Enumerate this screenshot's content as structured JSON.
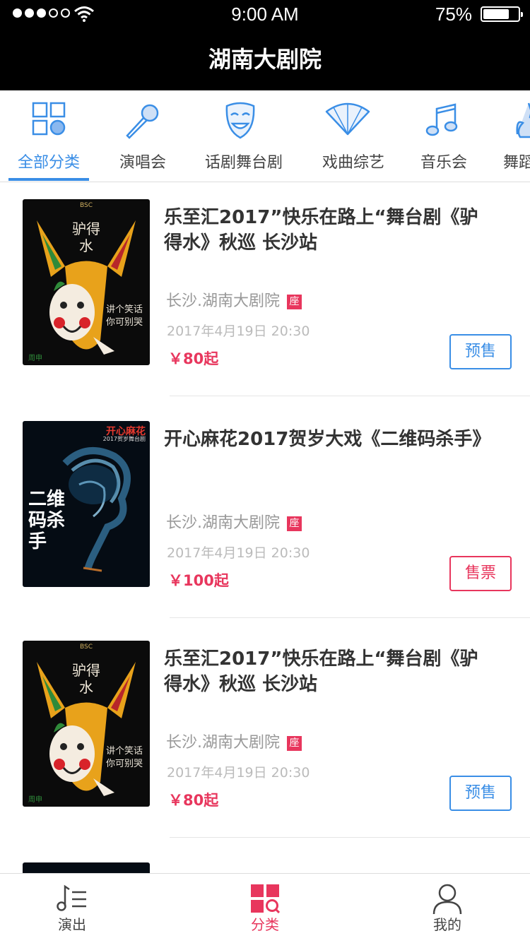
{
  "status": {
    "time": "9:00 AM",
    "battery": "75%"
  },
  "nav": {
    "title": "湖南大剧院"
  },
  "categories": [
    {
      "label": "全部分类",
      "icon": "grid-icon",
      "active": true
    },
    {
      "label": "演唱会",
      "icon": "microphone-icon"
    },
    {
      "label": "话剧舞台剧",
      "icon": "theater-mask-icon"
    },
    {
      "label": "戏曲综艺",
      "icon": "folding-fan-icon"
    },
    {
      "label": "音乐会",
      "icon": "music-note-icon"
    },
    {
      "label": "舞蹈",
      "icon": "dancer-icon"
    }
  ],
  "shows": [
    {
      "title": "乐至汇2017”快乐在路上“舞台剧《驴得水》秋巡 长沙站",
      "venue": "长沙.湖南大剧院",
      "seat": "座",
      "date": "2017年4月19日  20:30",
      "price": "￥80起",
      "button": "预售",
      "poster": {
        "title": "驴得水",
        "caption": "讲个笑话 你可别哭",
        "top": "BSC",
        "corner": "周申"
      }
    },
    {
      "title": "开心麻花2017贺岁大戏《二维码杀手》",
      "venue": "长沙.湖南大剧院",
      "seat": "座",
      "date": "2017年4月19日  20:30",
      "price": "￥100起",
      "button": "售票",
      "poster": {
        "brand": "开心麻花",
        "sub": "2017贺岁舞台剧",
        "title": "二维码杀手"
      }
    },
    {
      "title": "乐至汇2017”快乐在路上“舞台剧《驴得水》秋巡 长沙站",
      "venue": "长沙.湖南大剧院",
      "seat": "座",
      "date": "2017年4月19日  20:30",
      "price": "￥80起",
      "button": "预售",
      "poster": {
        "title": "驴得水",
        "caption": "讲个笑话 你可别哭",
        "top": "BSC",
        "corner": "周申"
      }
    }
  ],
  "tabs": [
    {
      "label": "演出",
      "icon": "music-list-icon"
    },
    {
      "label": "分类",
      "icon": "category-grid-icon",
      "active": true
    },
    {
      "label": "我的",
      "icon": "user-icon"
    }
  ],
  "colors": {
    "accent": "#3a8ee6",
    "brand_red": "#e8365d",
    "nav_bg": "#000000"
  }
}
